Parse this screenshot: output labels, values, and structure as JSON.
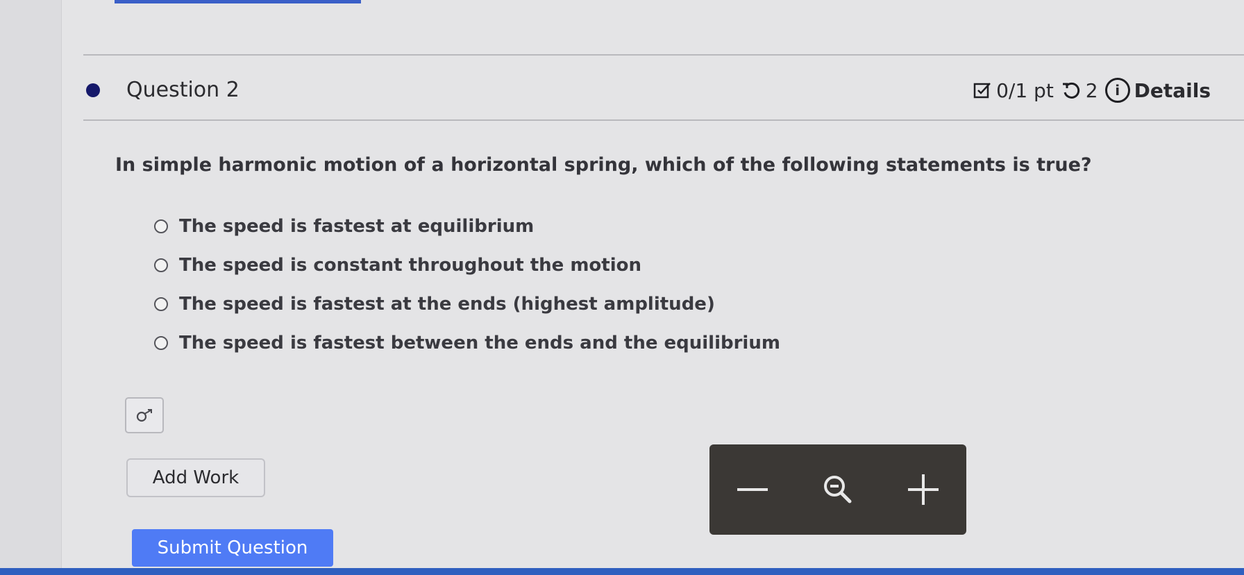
{
  "question": {
    "title": "Question 2",
    "score": "0/1 pt",
    "retries": "2",
    "details": "Details",
    "prompt": "In simple harmonic motion of a horizontal spring, which of the following statements is true?",
    "options": [
      "The speed is fastest at equilibrium",
      "The speed is constant throughout the motion",
      "The speed is fastest at the ends (highest amplitude)",
      "The speed is fastest between the ends and the equilibrium"
    ]
  },
  "buttons": {
    "add_work": "Add Work",
    "submit": "Submit Question"
  },
  "icons": {
    "score": "checkbox-edit-icon",
    "retry": "retry-icon",
    "info": "info-icon",
    "preview": "sigma-preview-icon",
    "zoom_out": "minus-icon",
    "zoom": "magnifier-icon",
    "zoom_in": "plus-icon"
  },
  "colors": {
    "accent": "#4f7bf5",
    "bullet": "#15186a",
    "zoom_bar": "#3b3835"
  }
}
